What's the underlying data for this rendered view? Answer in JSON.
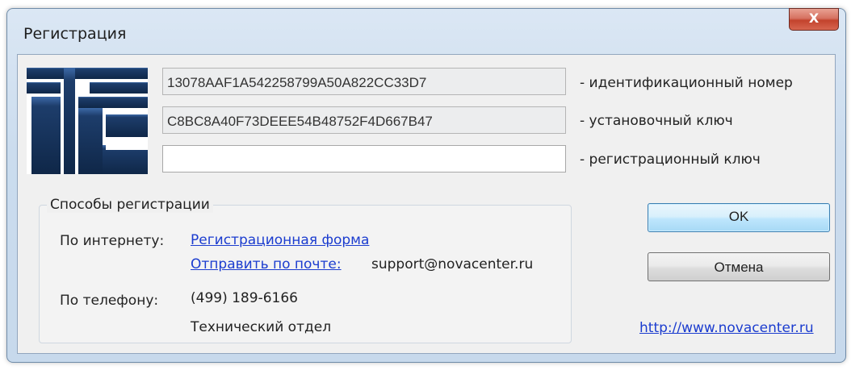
{
  "window": {
    "title": "Регистрация",
    "close_label": "X"
  },
  "fields": {
    "id_number": {
      "value": "13078AAF1A542258799A50A822CC33D7",
      "label": "- идентификационный номер"
    },
    "install_key": {
      "value": "C8BC8A40F73DEEE54B48752F4D667B47",
      "label": "- установочный ключ"
    },
    "reg_key": {
      "value": "",
      "label": "- регистрационный ключ"
    }
  },
  "registration": {
    "group_title": "Способы регистрации",
    "internet_label": "По интернету:",
    "form_link": "Регистрационная форма",
    "mail_link": "Отправить по почте:",
    "email": "support@novacenter.ru",
    "phone_label": "По телефону:",
    "phone": "(499) 189-6166",
    "department": "Технический отдел"
  },
  "buttons": {
    "ok": "OK",
    "cancel": "Отмена"
  },
  "website_link": "http://www.novacenter.ru",
  "colors": {
    "logo_blue": "#1d3d6b",
    "link": "#1b3ccf",
    "close_red": "#c3432d"
  }
}
